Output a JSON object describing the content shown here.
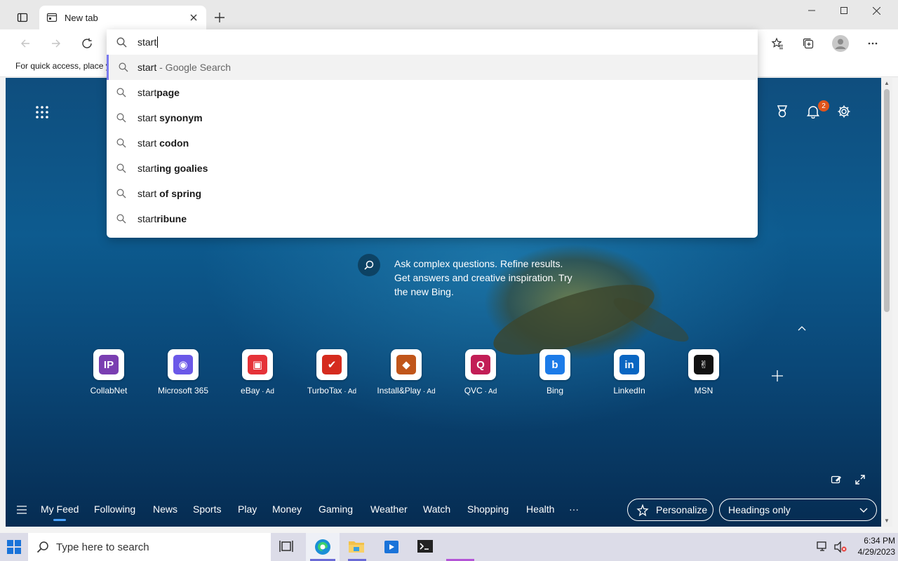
{
  "browser": {
    "tab_title": "New tab",
    "favorites_bar_text": "For quick access, place y",
    "address_value": "start"
  },
  "suggestions": [
    {
      "prefix": "start",
      "rest": "",
      "hint": " - Google Search",
      "selected": true
    },
    {
      "prefix": "start",
      "rest": "page",
      "hint": ""
    },
    {
      "prefix": "start ",
      "rest": "synonym",
      "hint": ""
    },
    {
      "prefix": "start ",
      "rest": "codon",
      "hint": ""
    },
    {
      "prefix": "start",
      "rest": "ing goalies",
      "hint": ""
    },
    {
      "prefix": "start ",
      "rest": "of spring",
      "hint": ""
    },
    {
      "prefix": "start",
      "rest": "ribune",
      "hint": ""
    }
  ],
  "new_tab_page": {
    "notification_count": "2",
    "bing_prompt": "Ask complex questions. Refine results. Get answers and creative inspiration. Try the new Bing.",
    "quick_links": [
      {
        "label": "CollabNet",
        "ad": "",
        "icon": "collabnet-icon",
        "color": "#7a3eb1",
        "glyph": "IP"
      },
      {
        "label": "Microsoft 365",
        "ad": "",
        "icon": "microsoft-365-icon",
        "color": "#6b58e8",
        "glyph": "◉"
      },
      {
        "label": "eBay",
        "ad": " · Ad",
        "icon": "ebay-icon",
        "color": "#e53238",
        "glyph": "▣"
      },
      {
        "label": "TurboTax",
        "ad": " · Ad",
        "icon": "turbotax-icon",
        "color": "#d52b1e",
        "glyph": "✔"
      },
      {
        "label": "Install&Play",
        "ad": " · Ad",
        "icon": "install-play-icon",
        "color": "#c0551a",
        "glyph": "◆"
      },
      {
        "label": "QVC",
        "ad": " · Ad",
        "icon": "qvc-icon",
        "color": "#c21e56",
        "glyph": "Q"
      },
      {
        "label": "Bing",
        "ad": "",
        "icon": "bing-icon",
        "color": "#1c7be8",
        "glyph": "b"
      },
      {
        "label": "LinkedIn",
        "ad": "",
        "icon": "linkedin-icon",
        "color": "#0a66c2",
        "glyph": "in"
      },
      {
        "label": "MSN",
        "ad": "",
        "icon": "msn-icon",
        "color": "#111111",
        "glyph": "✌"
      }
    ],
    "feed_nav": [
      "My Feed",
      "Following",
      "News",
      "Sports",
      "Play",
      "Money",
      "Gaming",
      "Weather",
      "Watch",
      "Shopping",
      "Health"
    ],
    "more_label": "···",
    "personalize_label": "Personalize",
    "headings_label": "Headings only"
  },
  "taskbar": {
    "search_placeholder": "Type here to search",
    "time": "6:34 PM",
    "date": "4/29/2023"
  }
}
